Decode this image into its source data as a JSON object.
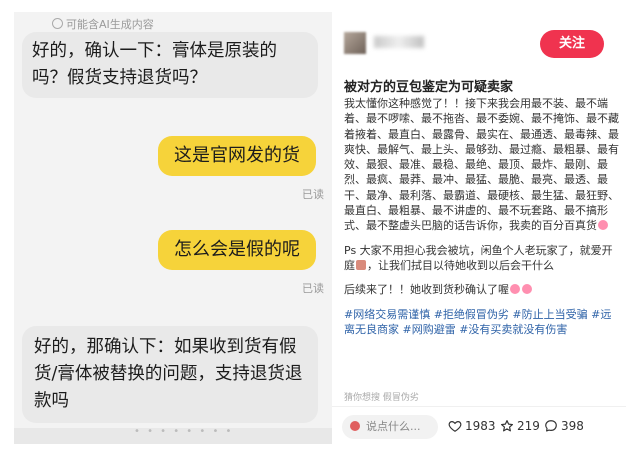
{
  "left_chat": {
    "ai_notice": "可能含AI生成内容",
    "messages": [
      {
        "side": "left",
        "text": "好的，确认一下：膏体是原装的吗？假货支持退货吗？"
      },
      {
        "side": "right",
        "text": "这是官网发的货",
        "status": "已读"
      },
      {
        "side": "right",
        "text": "怎么会是假的呢",
        "status": "已读"
      },
      {
        "side": "left",
        "text": "好的，那确认下：如果收到货有假货/膏体被替换的问题，支持退货退款吗"
      }
    ]
  },
  "post": {
    "follow_label": "关注",
    "title": "被对方的豆包鉴定为可疑卖家",
    "paragraph1": "我太懂你这种感觉了！！接下来我会用最不装、最不端着、最不啰嗦、最不拖沓、最不委婉、最不掩饰、最不藏着掖着、最直白、最露骨、最实在、最通透、最毒辣、最爽快、最解气、最上头、最够劲、最过瘾、最粗暴、最有效、最狠、最准、最稳、最绝、最顶、最炸、最刚、最烈、最疯、最莽、最冲、最猛、最脆、最亮、最透、最干、最净、最利落、最霸道、最硬核、最生猛、最狂野、最直白、最粗暴、最不讲虚的、最不玩套路、最不搞形式、最不整虚头巴脑的话告诉你，我卖的百分百真货",
    "paragraph2": "Ps 大家不用担心我会被坑，闲鱼个人老玩家了，就爱开庭",
    "paragraph2_tail": "，让我们拭目以待她收到以后会干什么",
    "paragraph3": "后续来了！！她收到货秒确认了喔",
    "tags": "#网络交易需谨慎 #拒绝假冒伪劣 #防止上当受骗 #远离无良商家 #网购避雷 #没有买卖就没有伤害",
    "related_text": "猜你想搜  假冒伪劣",
    "comment_placeholder": "说点什么...",
    "likes": "1983",
    "stars": "219",
    "comments": "398"
  },
  "icons": {
    "heart": "heart-icon",
    "star": "star-icon",
    "comment": "comment-icon"
  },
  "colors": {
    "follow_button": "#f0334f",
    "right_bubble": "#f6d33a",
    "tag_blue": "#2f63a8"
  }
}
